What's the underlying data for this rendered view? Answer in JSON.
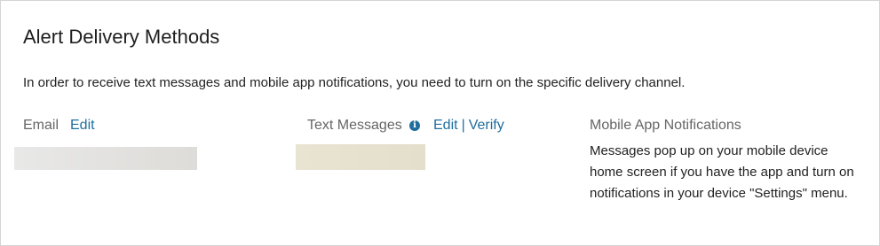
{
  "header": {
    "title": "Alert Delivery Methods"
  },
  "description": "In order to receive text messages and mobile app notifications, you need to turn on the specific delivery channel.",
  "email": {
    "label": "Email",
    "edit_label": "Edit"
  },
  "text_messages": {
    "label": "Text Messages",
    "info_icon": "info-icon",
    "edit_label": "Edit",
    "separator": "|",
    "verify_label": "Verify"
  },
  "mobile_app": {
    "label": "Mobile App Notifications",
    "description": "Messages pop up on your mobile device home screen if you have the app and turn on notifications in your device \"Settings\" menu."
  },
  "colors": {
    "link": "#1f6e9e",
    "label_gray": "#666666",
    "border": "#d4d4d4"
  }
}
